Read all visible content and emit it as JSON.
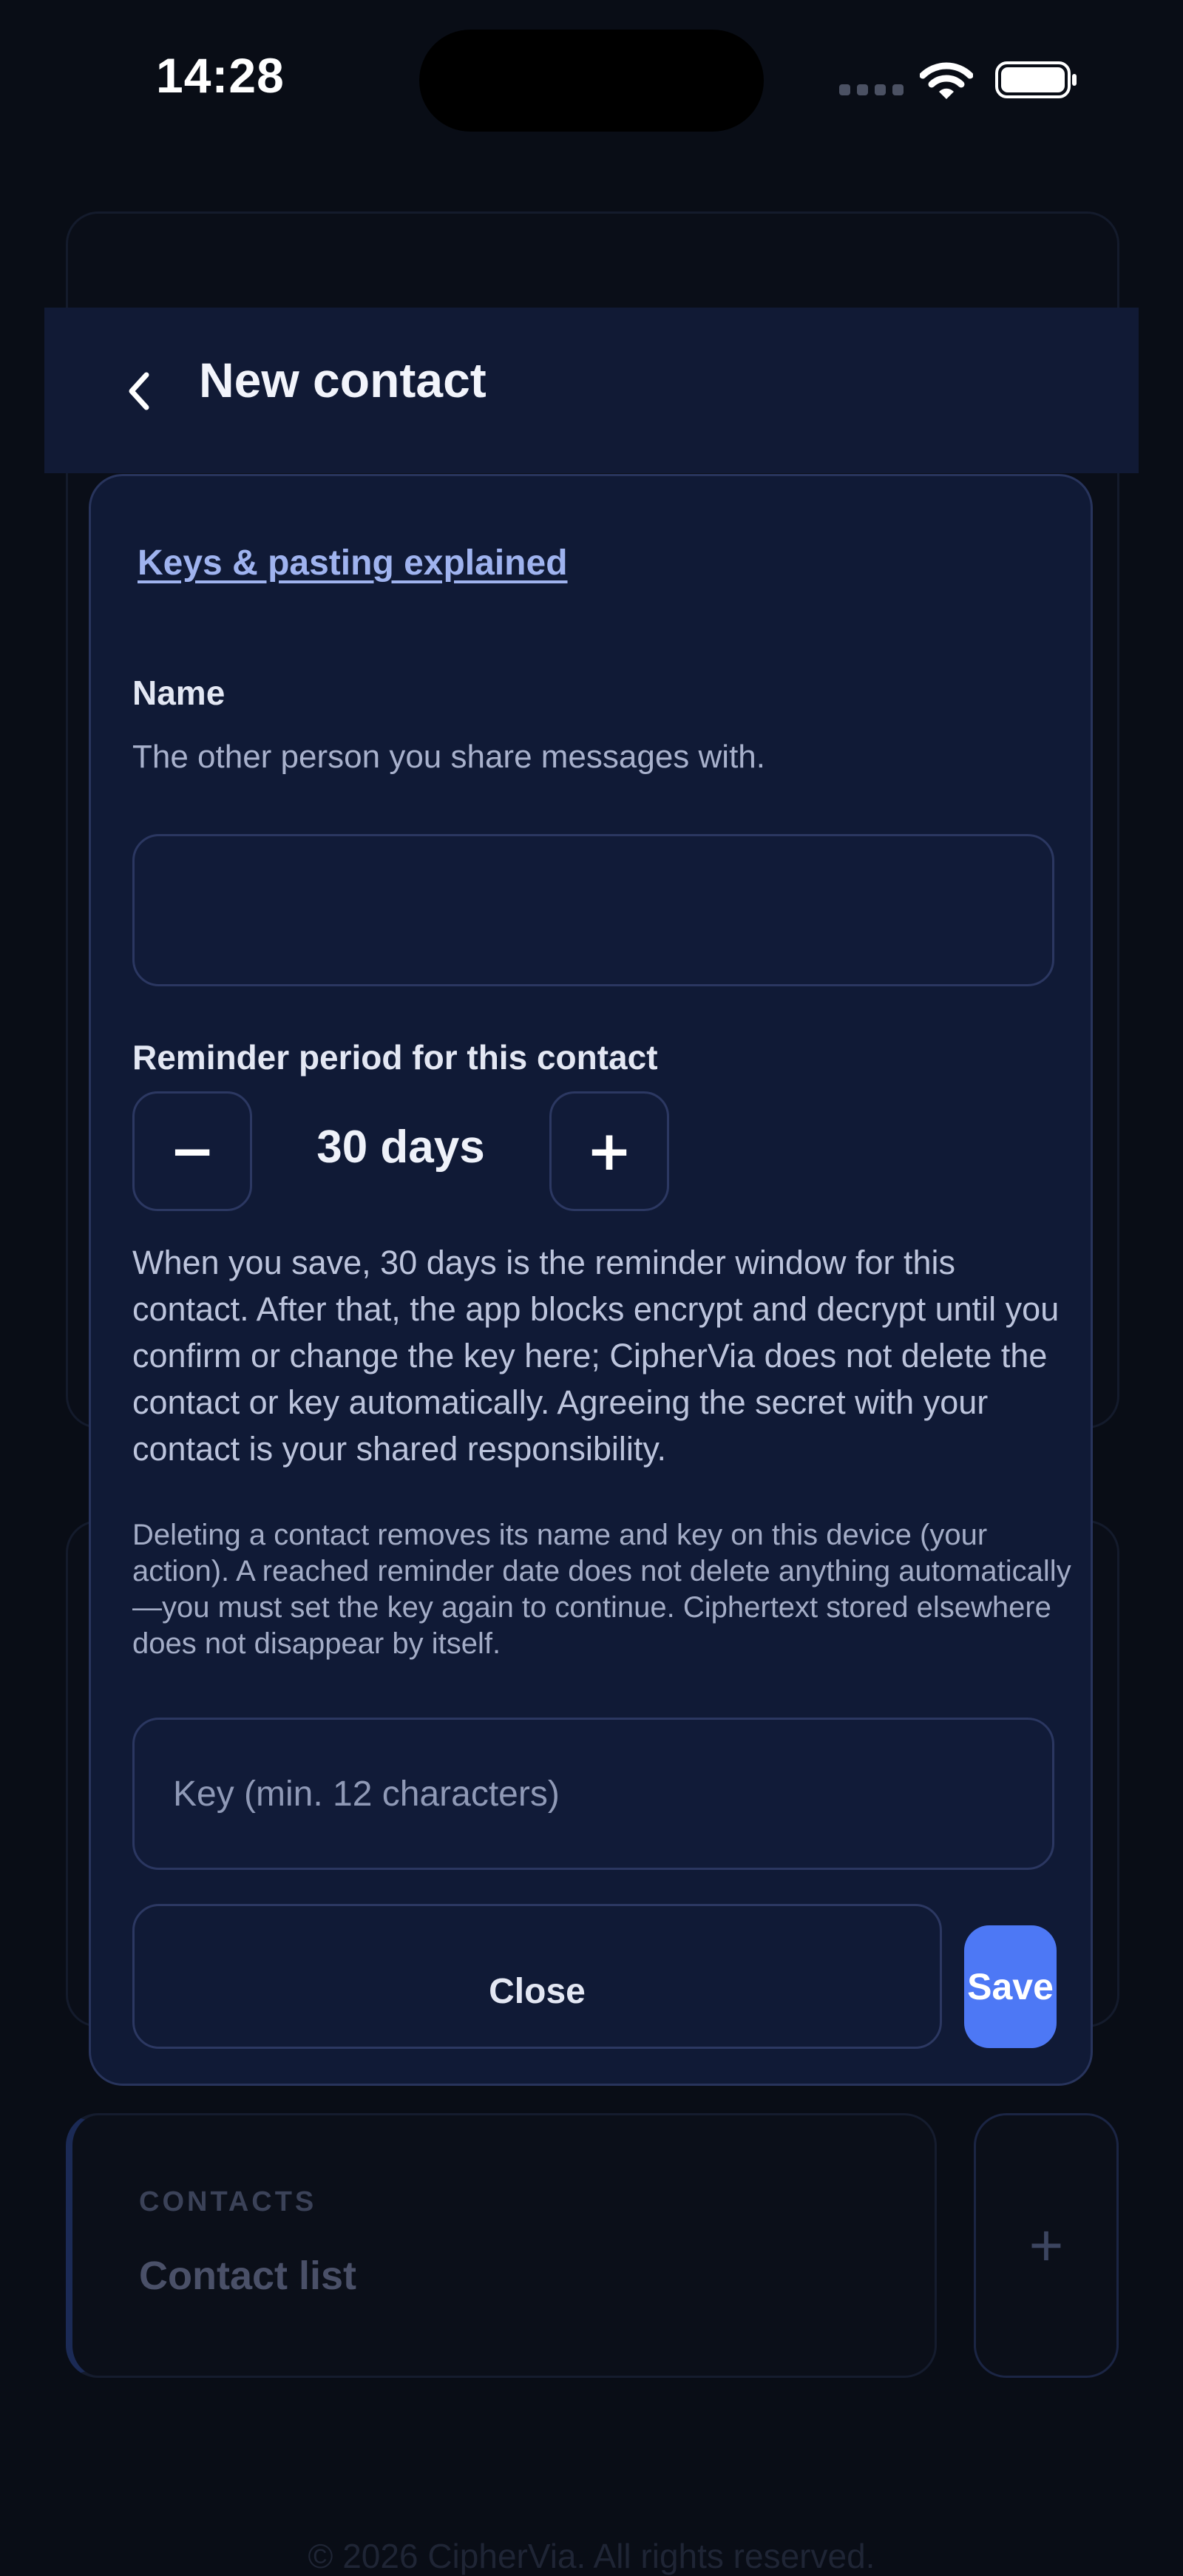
{
  "status_bar": {
    "time": "14:28",
    "icons": [
      "signal-icon",
      "wifi-icon",
      "battery-icon"
    ]
  },
  "header": {
    "back_icon": "chevron-left-icon",
    "title": "New contact"
  },
  "form": {
    "help_link": "Keys & pasting explained",
    "name_label": "Name",
    "name_hint": "The other person you share messages with.",
    "name_value": "",
    "name_placeholder": "",
    "reminder_label": "Reminder period for this contact",
    "reminder_minus": "−",
    "reminder_value": "30 days",
    "reminder_plus": "+",
    "reminder_explanation": "When you save, 30 days is the reminder window for this contact. After that, the app blocks encrypt and decrypt until you confirm or change the key here; CipherVia does not delete the contact or key automatically. Agreeing the secret with your contact is your shared responsibility.",
    "delete_note": "Deleting a contact removes its name and key on this device (your action). A reached reminder date does not delete anything automatically—you must set the key again to continue. Ciphertext stored elsewhere does not disappear by itself.",
    "key_value": "",
    "key_placeholder": "Key (min. 12 characters)",
    "close_label": "Close",
    "save_label": "Save"
  },
  "background": {
    "contacts_eyebrow": "CONTACTS",
    "contacts_title": "Contact list",
    "add_icon": "plus-icon",
    "add_label": "+",
    "footer": "© 2026 CipherVia. All rights reserved."
  },
  "colors": {
    "background": "#090d16",
    "sheet": "#101a36",
    "header": "#111a35",
    "accent": "#4d78f5",
    "link": "#9fb3ef"
  }
}
